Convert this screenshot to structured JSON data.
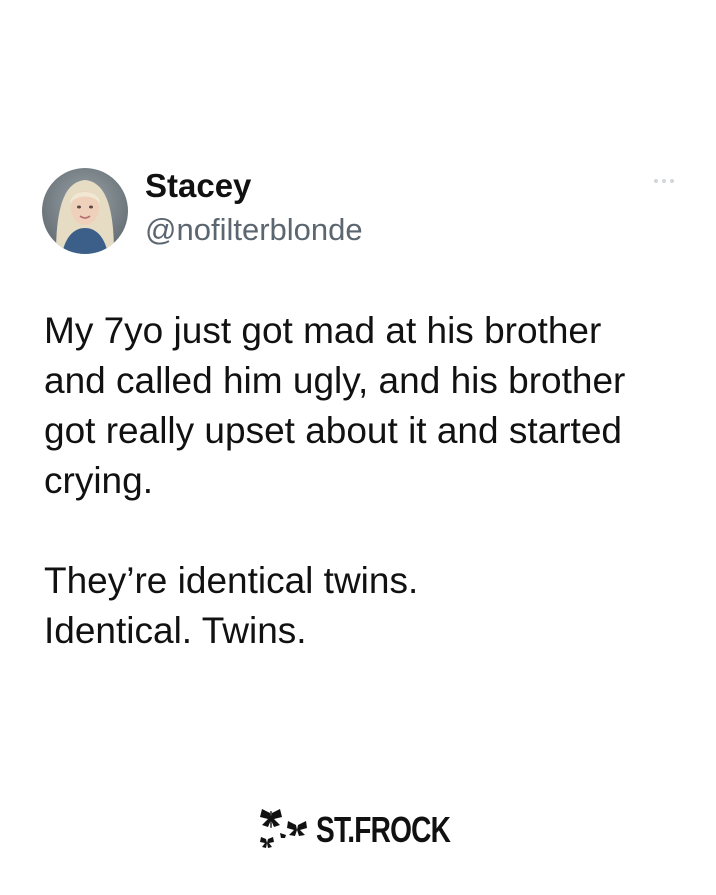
{
  "post": {
    "author": {
      "display_name": "Stacey",
      "handle": "@nofilterblonde",
      "avatar_icon": "profile-photo"
    },
    "more_icon": "more-horizontal-icon",
    "paragraphs": [
      "My 7yo just got mad at his brother\nand called him ugly, and his brother\ngot really upset about it and started\ncrying.",
      "They’re identical twins.\nIdentical. Twins."
    ]
  },
  "watermark": {
    "text": "ST.FROCK",
    "icon": "butterflies-icon"
  },
  "colors": {
    "background": "#ffffff",
    "text": "#111111",
    "handle": "#5c6670",
    "more_dots": "#d3d6da"
  }
}
